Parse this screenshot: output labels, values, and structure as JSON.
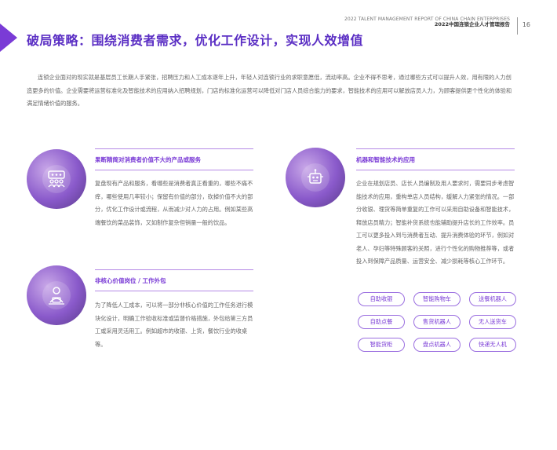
{
  "header": {
    "report_en": "2022 TALENT MANAGEMENT REPORT OF CHINA CHAIN ENTERPRISES",
    "report_cn": "2022中国连锁企业人才管理报告",
    "page_number": "16"
  },
  "title": "破局策略：围绕消费者需求，优化工作设计，实现人效增值",
  "intro": "连锁企业面对的现实就是基层员工长期人手紧张，招聘压力和人工成本逐年上升，年轻人对连锁行业的求职意愿低，流动率高。企业不得不思考，通过哪些方式可以提升人效，用有限的人力创造更多的价值。企业需要将运营标准化及智能技术的应用纳入招聘规划，门店的标准化运营可以降低对门店人员综合能力的要求，智能技术的应用可以解放店员人力，为顾客提供更个性化的体验和满足情绪价值的服务。",
  "sections": [
    {
      "heading": "果断精简对消费者价值不大的产品或服务",
      "body": "复盘现有产品和服务，看哪些是消费者真正看重的，哪些不痛不痒，哪些使用几率较小；保留有价值的部分，砍掉价值不大的部分，优化工作设计或流程，从而减少对人力的占用。例如某些高端餐饮的菜品装饰，又如制作复杂但销量一般的饮品。",
      "icon": "people-board-icon"
    },
    {
      "heading": "非核心价值岗位 / 工作外包",
      "body": "为了降低人工成本，可以将一部分非核心价值的工作任务进行模块化设计，明确工作验收标准或监督价格措施，外包给第三方员工或采用灵活用工。例如超市的收银、上货，餐饮行业的收桌等。",
      "icon": "outsource-worker-icon"
    },
    {
      "heading": "机器和智能技术的应用",
      "body": "企业在规划店员、店长人员编制及用人要求时，需要同步考虑智能技术的应用，重构单店人员结构，缓解人力紧张的情况。一部分收银、理货等简单重复的工作可以采用自助设备和智能技术，释放店员精力；智能补货系统也能辅助提升店长的工作效率。员工可以更多投入到与消费者互动、提升消费体验的环节，例如对老人、孕妇等特殊顾客的关照，进行个性化的购物推荐等，或者投入到保障产品质量、运营安全、减少损耗等核心工作环节。",
      "icon": "robot-gear-icon"
    }
  ],
  "tags": [
    "自助收银",
    "智能购物车",
    "送餐机器人",
    "自助点餐",
    "售货机器人",
    "无人送货车",
    "智能货柜",
    "盘点机器人",
    "快递无人机"
  ],
  "colors": {
    "accent": "#7a3bd6",
    "title": "#5b2fc4",
    "tag_border": "#9b6fe0"
  }
}
